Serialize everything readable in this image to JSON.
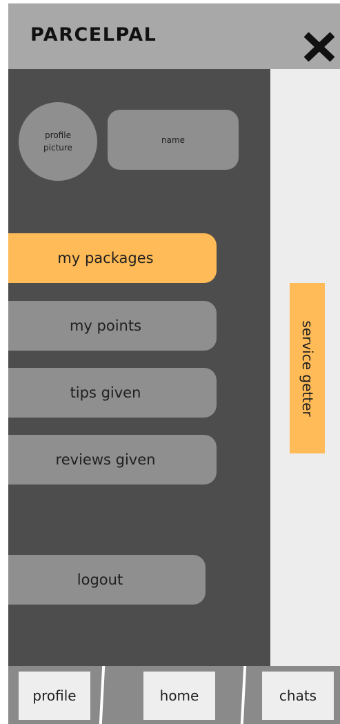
{
  "app": {
    "brand": "PARCELPAL"
  },
  "header": {
    "close_icon": "close-icon"
  },
  "profile": {
    "avatar_label": "profile picture",
    "name_label": "name"
  },
  "menu": {
    "items": [
      {
        "label": "my packages",
        "active": true
      },
      {
        "label": "my points",
        "active": false
      },
      {
        "label": "tips given",
        "active": false
      },
      {
        "label": "reviews given",
        "active": false
      }
    ],
    "logout_label": "logout"
  },
  "side_tab": {
    "label": "service getter"
  },
  "bottom_nav": {
    "items": [
      {
        "label": "profile"
      },
      {
        "label": "home"
      },
      {
        "label": "chats"
      }
    ]
  },
  "colors": {
    "accent": "#ffbb57",
    "header_bg": "#a8a8a8",
    "drawer_bg": "#4d4d4d",
    "item_bg": "#8f8f8f",
    "page_bg": "#ededed"
  }
}
